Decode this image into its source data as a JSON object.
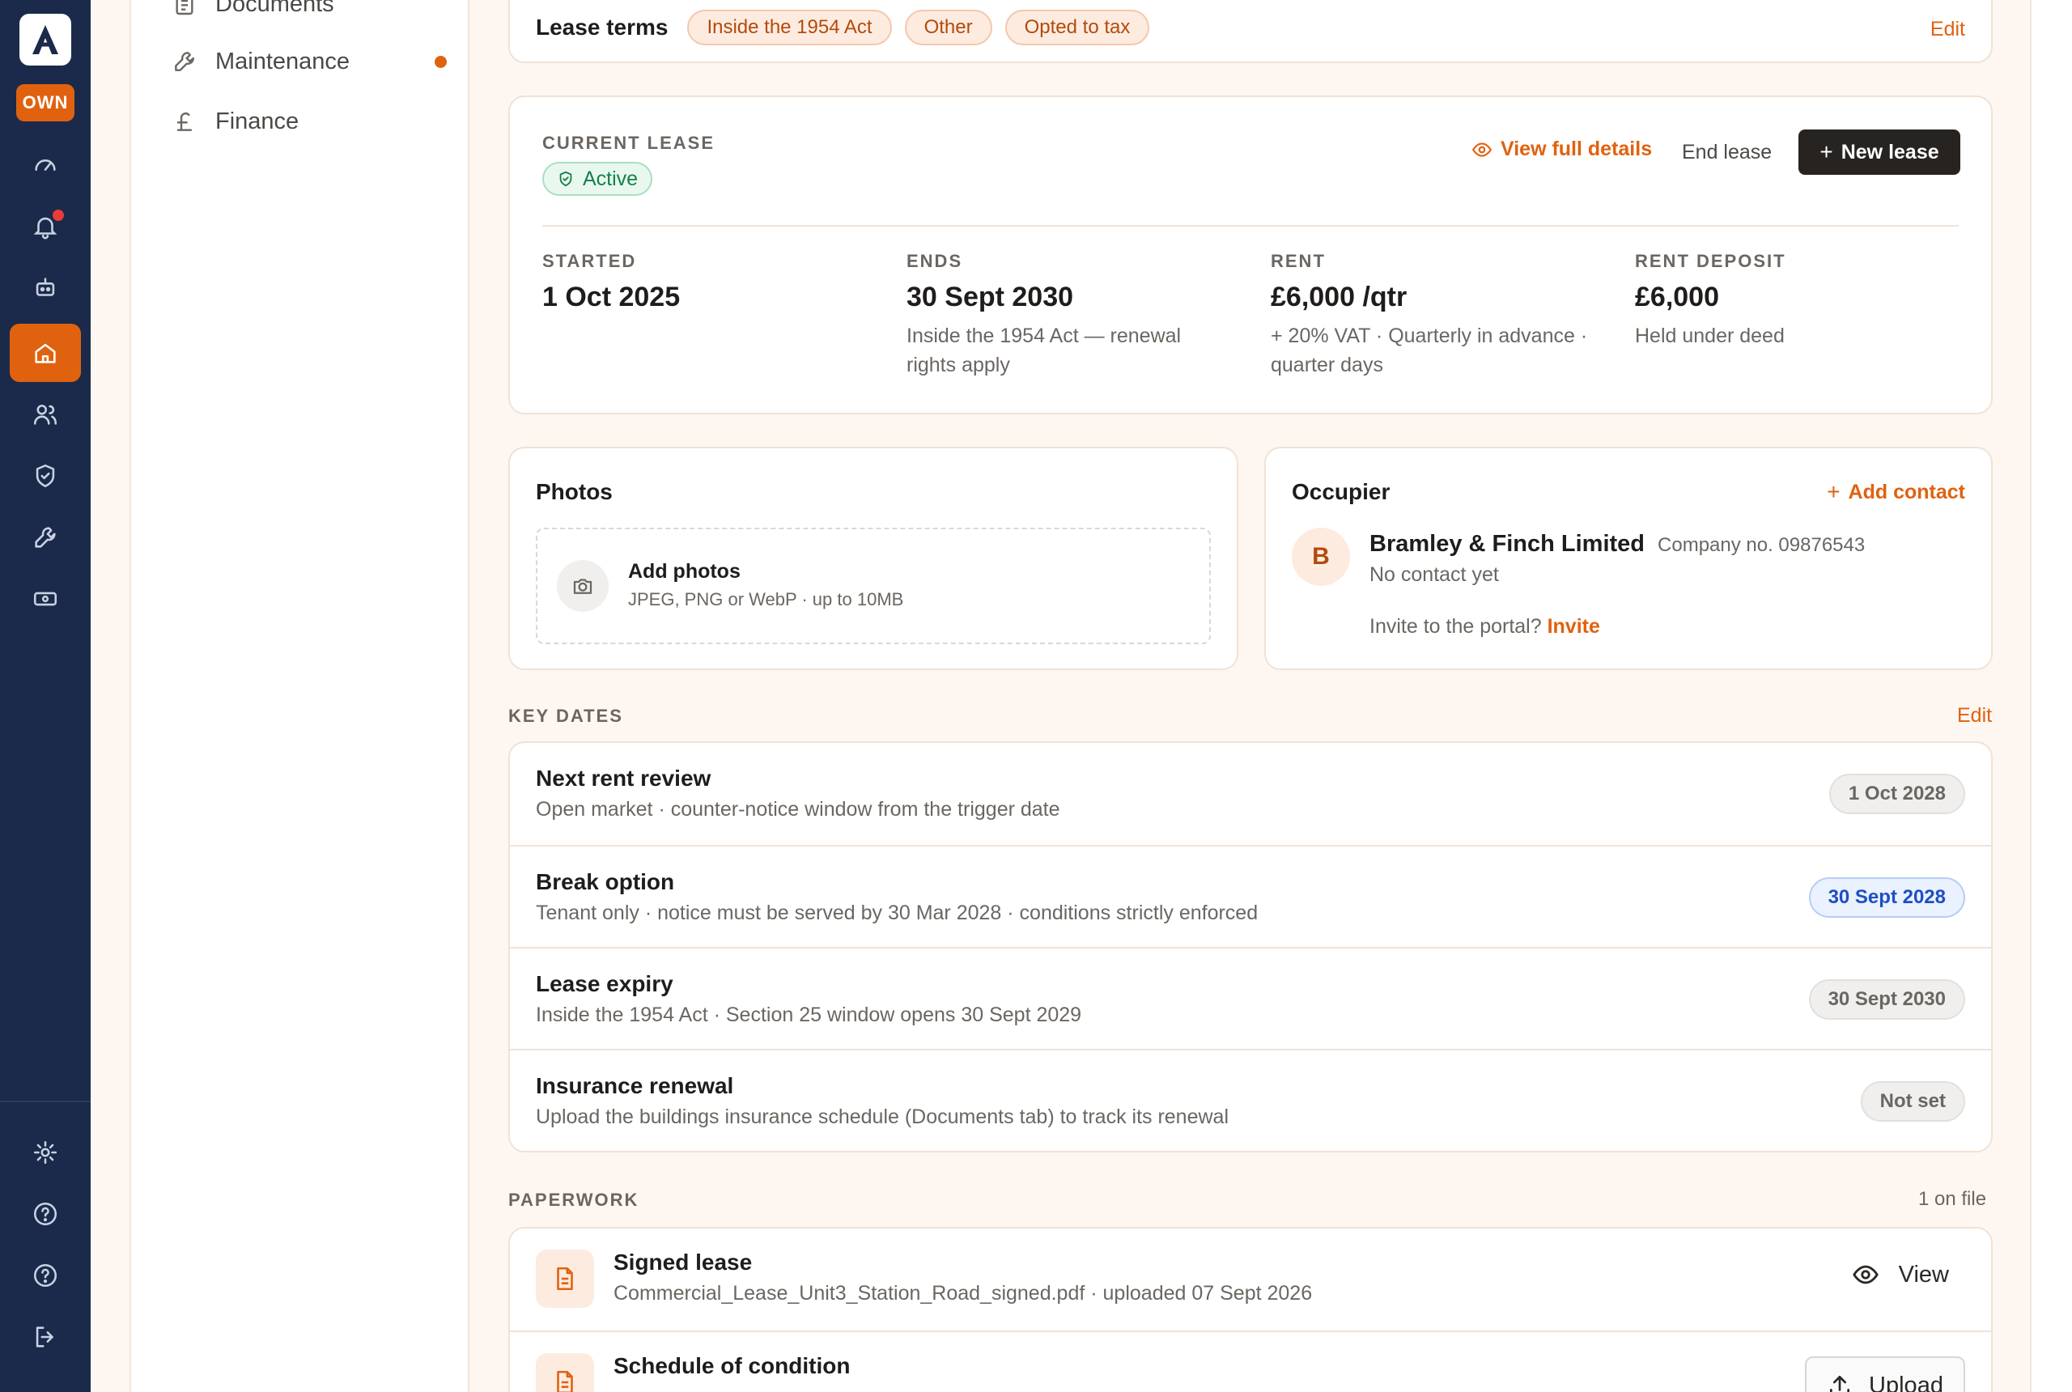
{
  "rail": {
    "logo_letter": "A",
    "badge": "OWN",
    "items": [
      {
        "icon": "gauge-icon"
      },
      {
        "icon": "bell-icon"
      },
      {
        "icon": "robot-icon"
      },
      {
        "icon": "home-icon"
      },
      {
        "icon": "users-icon"
      },
      {
        "icon": "shield-icon"
      },
      {
        "icon": "wrench-icon"
      },
      {
        "icon": "cash-icon"
      },
      {
        "icon": "gear-icon"
      },
      {
        "icon": "help-icon"
      },
      {
        "icon": "help-icon"
      },
      {
        "icon": "logout-icon"
      }
    ],
    "accent": "#e0620f",
    "background": "#1b2a4a"
  },
  "sidebar": {
    "items": [
      {
        "label": "Documents",
        "icon": "document-icon"
      },
      {
        "label": "Maintenance",
        "icon": "wrench-icon"
      },
      {
        "label": "Finance",
        "icon": "pound-icon"
      }
    ]
  },
  "lease_terms": {
    "title": "Lease terms",
    "tags": [
      "Inside the 1954 Act",
      "Other",
      "Opted to tax"
    ],
    "edit": "Edit"
  },
  "current_lease": {
    "label": "CURRENT LEASE",
    "status": "Active",
    "view_details": "View full details",
    "end_lease": "End lease",
    "new_lease": "New lease",
    "stats": [
      {
        "label": "STARTED",
        "value": "1 Oct 2025",
        "note": ""
      },
      {
        "label": "ENDS",
        "value": "30 Sept 2030",
        "note": "Inside the 1954 Act — renewal rights apply"
      },
      {
        "label": "RENT",
        "value": "£6,000 /qtr",
        "note": "+ 20% VAT · Quarterly in advance · quarter days"
      },
      {
        "label": "RENT DEPOSIT",
        "value": "£6,000",
        "note": "Held under deed"
      }
    ]
  },
  "photos": {
    "title": "Photos",
    "add_title": "Add photos",
    "add_sub": "JPEG, PNG or WebP · up to 10MB"
  },
  "occupier": {
    "title": "Occupier",
    "add_contact": "Add contact",
    "avatar": "B",
    "name": "Bramley & Finch Limited",
    "company_no": "Company no. 09876543",
    "contact": "No contact yet",
    "invite_text": "Invite to the portal?",
    "invite_link": "Invite"
  },
  "key_dates": {
    "label": "KEY DATES",
    "edit": "Edit",
    "rows": [
      {
        "title": "Next rent review",
        "sub": "Open market · counter-notice window from the trigger date",
        "date": "1 Oct 2028",
        "style": "grey"
      },
      {
        "title": "Break option",
        "sub": "Tenant only · notice must be served by 30 Mar 2028 · conditions strictly enforced",
        "date": "30 Sept 2028",
        "style": "blue"
      },
      {
        "title": "Lease expiry",
        "sub": "Inside the 1954 Act · Section 25 window opens 30 Sept 2029",
        "date": "30 Sept 2030",
        "style": "grey"
      },
      {
        "title": "Insurance renewal",
        "sub": "Upload the buildings insurance schedule (Documents tab) to track its renewal",
        "date": "Not set",
        "style": "grey"
      }
    ]
  },
  "paperwork": {
    "label": "PAPERWORK",
    "count": "1 on file",
    "rows": [
      {
        "title": "Signed lease",
        "sub": "Commercial_Lease_Unit3_Station_Road_signed.pdf · uploaded 07 Sept 2026",
        "action": "View"
      },
      {
        "title": "Schedule of condition",
        "sub": "",
        "action": "Upload"
      }
    ]
  }
}
